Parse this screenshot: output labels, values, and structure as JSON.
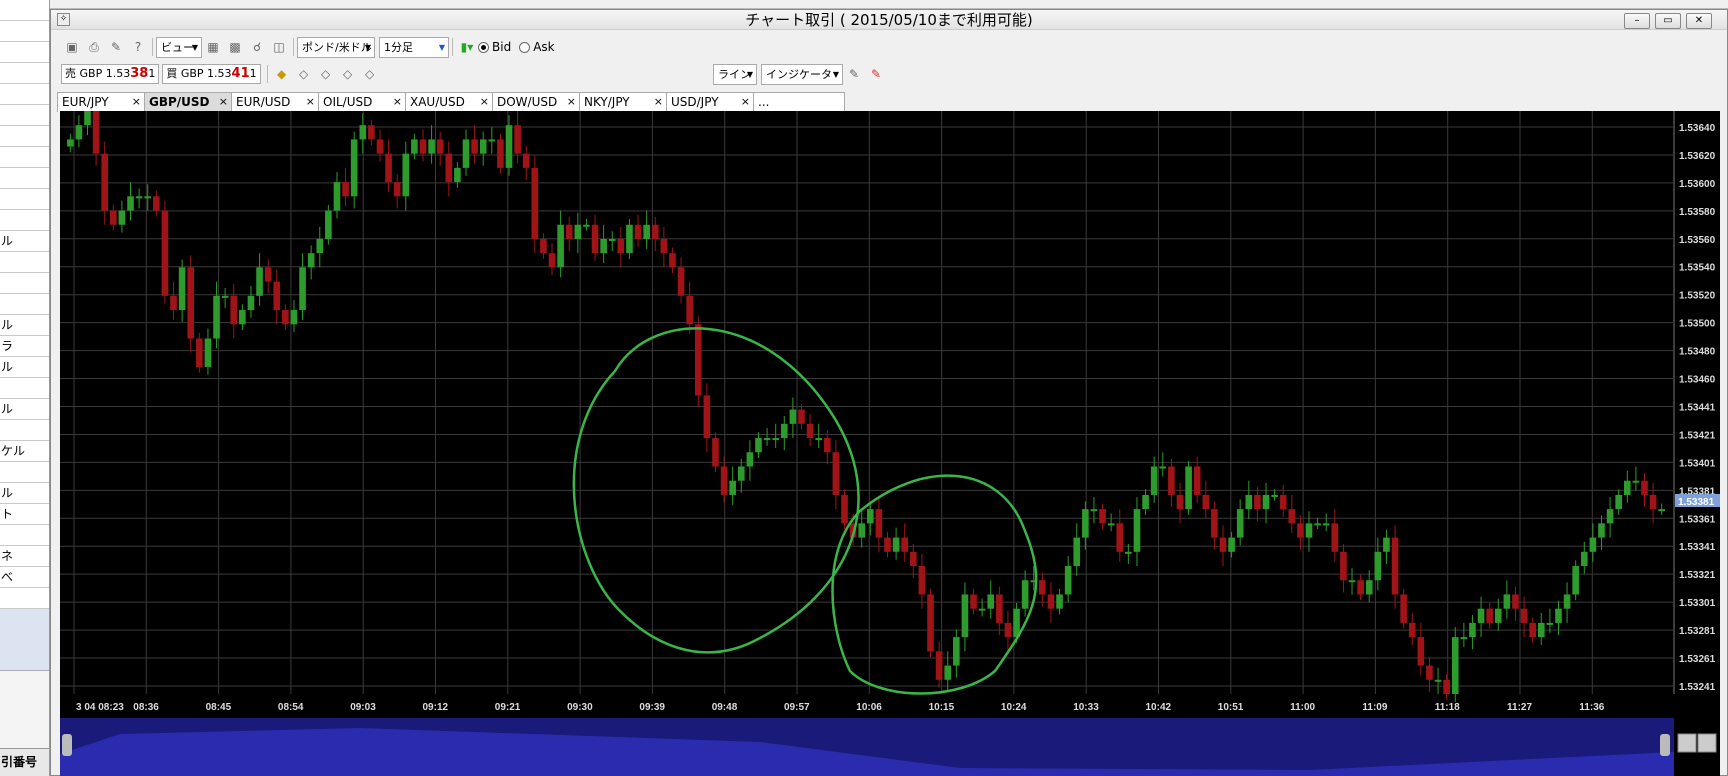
{
  "left_panel": {
    "rows": [
      "",
      "",
      "",
      "",
      "",
      "",
      "",
      "",
      "",
      "",
      "",
      "ル",
      "",
      "",
      "",
      "ル",
      "ラ",
      "ル",
      "",
      "ル",
      "",
      "ケル",
      "",
      "ル",
      "ト",
      "",
      "ネ",
      "べ",
      ""
    ],
    "footer": "引番号"
  },
  "window": {
    "title": "チャート取引 ( 2015/05/10まで利用可能)",
    "minimize": "–",
    "restore": "▭",
    "close": "✕"
  },
  "toolbar": {
    "view_menu": "ビュー",
    "symbol_select": "ポンド/米ドル",
    "timeframe_select": "1分足",
    "bid_label": "Bid",
    "ask_label": "Ask",
    "sell_label": "売",
    "sell_ccy": "GBP",
    "sell_price_main": "1.53",
    "sell_price_big": "38",
    "sell_price_tail": "1",
    "buy_label": "買",
    "buy_ccy": "GBP",
    "buy_price_main": "1.53",
    "buy_price_big": "41",
    "buy_price_tail": "1",
    "line_menu": "ライン",
    "indicator_menu": "インジケーター"
  },
  "tabs": [
    {
      "label": "EUR/JPY",
      "active": false
    },
    {
      "label": "GBP/USD",
      "active": true
    },
    {
      "label": "EUR/USD",
      "active": false
    },
    {
      "label": "OIL/USD",
      "active": false
    },
    {
      "label": "XAU/USD",
      "active": false
    },
    {
      "label": "DOW/USD",
      "active": false
    },
    {
      "label": "NKY/JPY",
      "active": false
    },
    {
      "label": "USD/JPY",
      "active": false
    },
    {
      "label": "...",
      "active": false
    }
  ],
  "colors": {
    "background": "#000000",
    "grid": "#3a3a3a",
    "up": "#2d9c2d",
    "down": "#a01418",
    "annotation": "#3bb54a",
    "navigator": "#2b2bb0"
  },
  "chart_data": {
    "type": "candlestick",
    "ylim": [
      1.5324,
      1.5365
    ],
    "y_ticks": [
      "1.53640",
      "1.53620",
      "1.53600",
      "1.53580",
      "1.53560",
      "1.53540",
      "1.53520",
      "1.53500",
      "1.53480",
      "1.53460",
      "1.53441",
      "1.53421",
      "1.53401",
      "1.53381",
      "1.53361",
      "1.53341",
      "1.53321",
      "1.53301",
      "1.53281",
      "1.53261",
      "1.53241"
    ],
    "current_price": "1.53381",
    "x_ticks": [
      "3 04 08:23",
      "08:36",
      "08:45",
      "08:54",
      "09:03",
      "09:12",
      "09:21",
      "09:30",
      "09:39",
      "09:48",
      "09:57",
      "10:06",
      "10:15",
      "10:24",
      "10:33",
      "10:42",
      "10:51",
      "11:00",
      "11:09",
      "11:18",
      "11:27",
      "11:36"
    ],
    "annotations": [
      "circle-around-09:30-09:48-drop",
      "circle-around-09:57-10:12-low"
    ],
    "closes": [
      1.5363,
      1.5364,
      1.5365,
      1.5362,
      1.5358,
      1.5357,
      1.5358,
      1.5359,
      1.5359,
      1.5359,
      1.5358,
      1.5352,
      1.5351,
      1.5354,
      1.5349,
      1.5347,
      1.5349,
      1.5352,
      1.5352,
      1.535,
      1.5351,
      1.5352,
      1.5354,
      1.5353,
      1.5351,
      1.535,
      1.5351,
      1.5354,
      1.5355,
      1.5356,
      1.5358,
      1.536,
      1.5359,
      1.5363,
      1.5364,
      1.5363,
      1.5362,
      1.536,
      1.5359,
      1.5362,
      1.5363,
      1.5362,
      1.5363,
      1.5362,
      1.536,
      1.5361,
      1.5363,
      1.5362,
      1.5363,
      1.5363,
      1.5361,
      1.5364,
      1.5362,
      1.5361,
      1.5356,
      1.5355,
      1.5354,
      1.5357,
      1.5356,
      1.5357,
      1.5357,
      1.5355,
      1.5356,
      1.5356,
      1.5355,
      1.5357,
      1.5356,
      1.5357,
      1.5356,
      1.5355,
      1.5354,
      1.5352,
      1.535,
      1.5345,
      1.5342,
      1.534,
      1.5338,
      1.5339,
      1.534,
      1.5341,
      1.5342,
      1.5342,
      1.5342,
      1.5343,
      1.5344,
      1.5343,
      1.5342,
      1.5342,
      1.5341,
      1.5338,
      1.5336,
      1.5335,
      1.5336,
      1.5337,
      1.5335,
      1.5334,
      1.5335,
      1.5334,
      1.5333,
      1.5331,
      1.5327,
      1.5325,
      1.5326,
      1.5328,
      1.5331,
      1.533,
      1.533,
      1.5331,
      1.5329,
      1.5328,
      1.533,
      1.5332,
      1.5332,
      1.5331,
      1.533,
      1.5331,
      1.5333,
      1.5335,
      1.5337,
      1.5337,
      1.5336,
      1.5336,
      1.5334,
      1.5334,
      1.5337,
      1.5338,
      1.534,
      1.534,
      1.5338,
      1.5337,
      1.534,
      1.5338,
      1.5337,
      1.5335,
      1.5334,
      1.5335,
      1.5337,
      1.5338,
      1.5337,
      1.5338,
      1.5338,
      1.5337,
      1.5336,
      1.5335,
      1.5336,
      1.5336,
      1.5336,
      1.5334,
      1.5332,
      1.5332,
      1.5331,
      1.5332,
      1.5334,
      1.5335,
      1.5331,
      1.5329,
      1.5328,
      1.5326,
      1.5325,
      1.5325,
      1.5324,
      1.5328,
      1.5328,
      1.5329,
      1.533,
      1.5329,
      1.533,
      1.5331,
      1.533,
      1.5329,
      1.5328,
      1.5329,
      1.5329,
      1.533,
      1.5331,
      1.5333,
      1.5334,
      1.5335,
      1.5336,
      1.5337,
      1.5338,
      1.5339,
      1.5339,
      1.5338,
      1.5337,
      1.5337
    ]
  }
}
